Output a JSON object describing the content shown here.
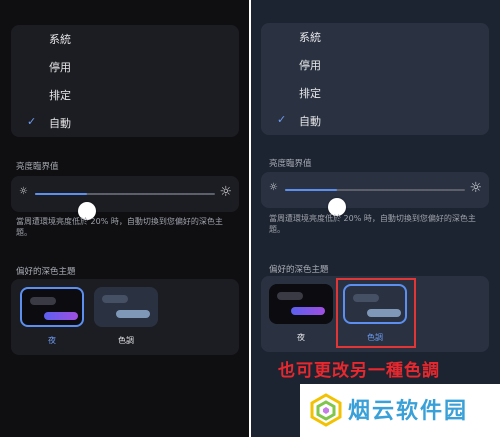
{
  "left": {
    "menu": [
      {
        "label": "系統",
        "checked": false
      },
      {
        "label": "停用",
        "checked": false
      },
      {
        "label": "排定",
        "checked": false
      },
      {
        "label": "自動",
        "checked": true
      }
    ],
    "brightness_title": "亮度臨界值",
    "brightness_level": 0.29,
    "description": "當周遭環境亮度低於 20% 時，自動切換到您偏好的深色主題。",
    "theme_title": "偏好的深色主題",
    "themes": [
      {
        "label": "夜",
        "selected": true
      },
      {
        "label": "色調",
        "selected": false
      }
    ]
  },
  "right": {
    "menu": [
      {
        "label": "系統",
        "checked": false
      },
      {
        "label": "停用",
        "checked": false
      },
      {
        "label": "排定",
        "checked": false
      },
      {
        "label": "自動",
        "checked": true
      }
    ],
    "brightness_title": "亮度臨界值",
    "brightness_level": 0.29,
    "description": "當周遭環境亮度低於 20% 時，自動切換到您偏好的深色主題。",
    "theme_title": "偏好的深色主題",
    "themes": [
      {
        "label": "夜",
        "selected": false
      },
      {
        "label": "色調",
        "selected": true
      }
    ]
  },
  "annotation": "也可更改另一種色調",
  "watermark": "烟云软件园",
  "icons": {
    "check": "checkmark-icon",
    "sun_small": "sun-small-icon",
    "sun_large": "sun-large-icon"
  },
  "colors": {
    "accent": "#5c8ff0",
    "highlight": "#e23636",
    "caption": "#e7282e",
    "watermark": "#3aa0d8"
  }
}
